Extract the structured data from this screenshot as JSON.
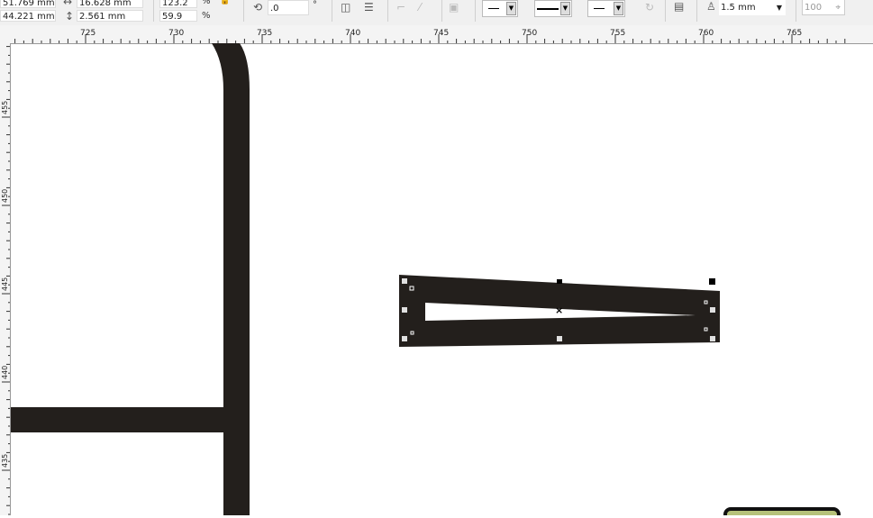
{
  "toolbar": {
    "x_pos": "51.769 mm",
    "y_pos": "44.221 mm",
    "width": "16.628 mm",
    "height": "2.561 mm",
    "scale_x": "123.2",
    "scale_y": "59.9",
    "pct1": "%",
    "pct2": "%",
    "rotation": ".0",
    "degree": "°",
    "outline_width": "1.5 mm",
    "opacity": "100",
    "icons": [
      "width-icon",
      "height-icon",
      "lock-ratio-icon",
      "rotate-icon",
      "mirror-horizontal-icon",
      "mirror-vertical-icon",
      "align-icon",
      "node-icon",
      "line-icon",
      "copy-properties-icon",
      "start-arrow-dropdown",
      "line-style-dropdown",
      "end-arrow-dropdown",
      "wrap-icon",
      "convert-icon",
      "outline-pen-icon",
      "more-icon"
    ]
  },
  "rulers": {
    "horizontal": [
      "725",
      "730",
      "735",
      "740",
      "745",
      "750",
      "755",
      "760",
      "765"
    ],
    "vertical": [
      "455",
      "450",
      "445",
      "440",
      "435"
    ]
  },
  "colors": {
    "shape": "#231f1c",
    "handle": "#e0e0e0"
  }
}
